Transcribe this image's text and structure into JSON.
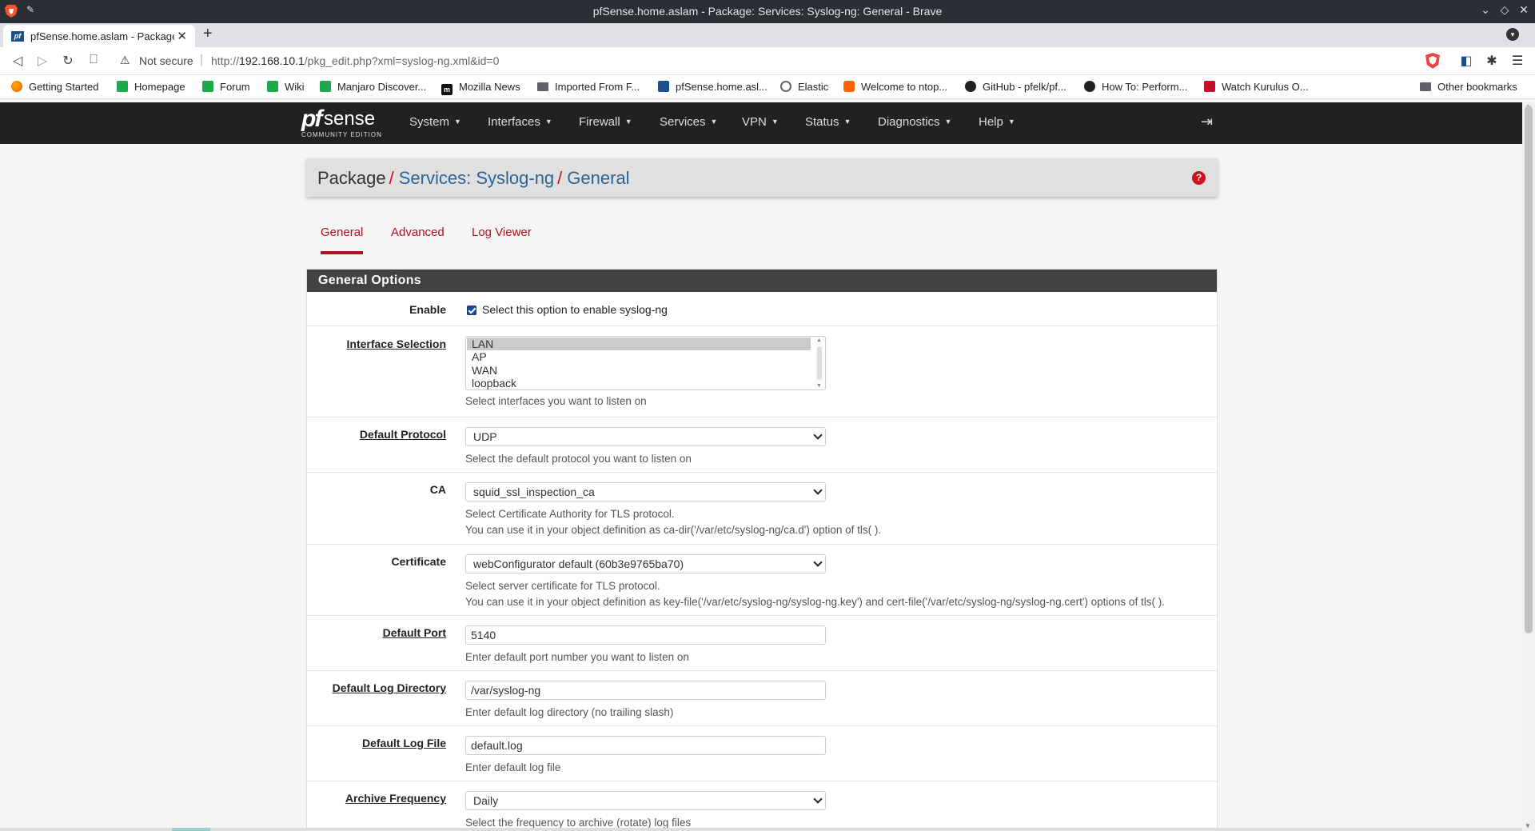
{
  "window": {
    "title": "pfSense.home.aslam - Package: Services: Syslog-ng: General - Brave"
  },
  "tabbar": {
    "tab_title": "pfSense.home.aslam - Package: Services: Syslog-ng: General",
    "favicon_text": "pf"
  },
  "addressbar": {
    "security": "Not secure",
    "url_prefix": "http://",
    "url_host": "192.168.10.1",
    "url_path": "/pkg_edit.php?xml=syslog-ng.xml&id=0"
  },
  "bookmarks": [
    "Getting Started",
    "Homepage",
    "Forum",
    "Wiki",
    "Manjaro Discover...",
    "Mozilla News",
    "Imported From F...",
    "pfSense.home.asl...",
    "Elastic",
    "Welcome to ntop...",
    "GitHub - pfelk/pf...",
    "How To: Perform...",
    "Watch Kurulus O..."
  ],
  "other_bookmarks": "Other bookmarks",
  "pf_logo": {
    "main": "pf",
    "sub": "sense",
    "edition": "COMMUNITY EDITION"
  },
  "pf_menu": [
    "System",
    "Interfaces",
    "Firewall",
    "Services",
    "VPN",
    "Status",
    "Diagnostics",
    "Help"
  ],
  "breadcrumb": {
    "root": "Package",
    "mid": "Services: Syslog-ng",
    "leaf": "General"
  },
  "subtabs": [
    "General",
    "Advanced",
    "Log Viewer"
  ],
  "panel_title": "General Options",
  "form": {
    "enable": {
      "label": "Enable",
      "checkbox_label": "Select this option to enable syslog-ng",
      "checked": true
    },
    "interface_selection": {
      "label": "Interface Selection",
      "options": [
        "LAN",
        "AP",
        "WAN",
        "loopback"
      ],
      "selected": "LAN",
      "hint": "Select interfaces you want to listen on"
    },
    "default_protocol": {
      "label": "Default Protocol",
      "value": "UDP",
      "hint": "Select the default protocol you want to listen on"
    },
    "ca": {
      "label": "CA",
      "value": "squid_ssl_inspection_ca",
      "hint1": "Select Certificate Authority for TLS protocol.",
      "hint2": "You can use it in your object definition as ca-dir('/var/etc/syslog-ng/ca.d') option of tls( )."
    },
    "certificate": {
      "label": "Certificate",
      "value": "webConfigurator default (60b3e9765ba70)",
      "hint1": "Select server certificate for TLS protocol.",
      "hint2": "You can use it in your object definition as key-file('/var/etc/syslog-ng/syslog-ng.key') and cert-file('/var/etc/syslog-ng/syslog-ng.cert') options of tls( )."
    },
    "default_port": {
      "label": "Default Port",
      "value": "5140",
      "hint": "Enter default port number you want to listen on"
    },
    "default_log_directory": {
      "label": "Default Log Directory",
      "value": "/var/syslog-ng",
      "hint": "Enter default log directory (no trailing slash)"
    },
    "default_log_file": {
      "label": "Default Log File",
      "value": "default.log",
      "hint": "Enter default log file"
    },
    "archive_frequency": {
      "label": "Archive Frequency",
      "value": "Daily",
      "hint": "Select the frequency to archive (rotate) log files"
    }
  },
  "colors": {
    "pf_red": "#b3101f",
    "pf_link": "#2a6496",
    "nav_bg": "#212121",
    "panel_head": "#424242"
  }
}
